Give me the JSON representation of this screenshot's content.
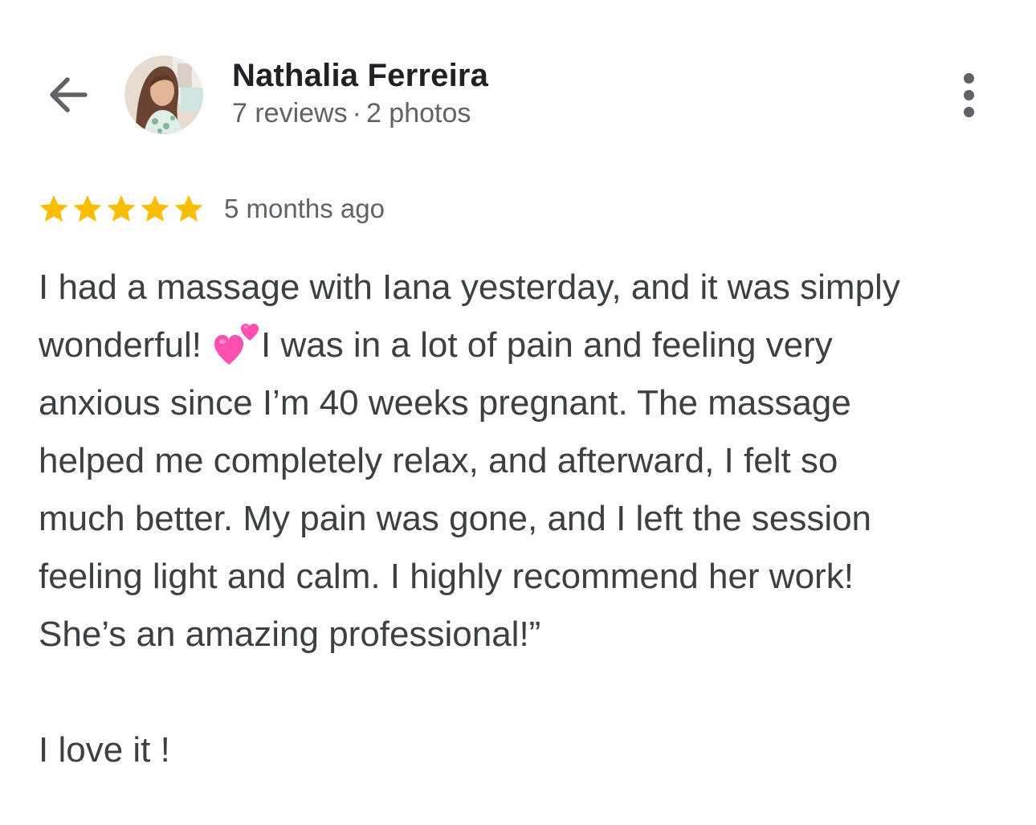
{
  "reviewer": {
    "name": "Nathalia Ferreira",
    "reviews": "7 reviews",
    "separator": "·",
    "photos": "2 photos"
  },
  "rating": {
    "stars": 5,
    "max_stars": 5,
    "time_ago": "5 months ago",
    "star_color": "#fbbc04"
  },
  "review": {
    "line1": "I had a massage with Iana yesterday, and it was simply",
    "line2a": "wonderful!",
    "line2_emoji": "revolving-hearts-emoji",
    "line2b": "I was in a lot of pain and feeling very",
    "line3": "anxious since I’m 40 weeks pregnant. The massage",
    "line4": "helped me completely relax, and afterward, I felt so",
    "line5": "much better. My pain was gone, and I left the session",
    "line6": "feeling light and calm. I highly recommend her work!",
    "line7": "She’s an amazing professional!”",
    "line8": "I love it !"
  },
  "icons": {
    "back": "arrow-back-icon",
    "more": "more-vert-icon",
    "star": "star-icon"
  }
}
